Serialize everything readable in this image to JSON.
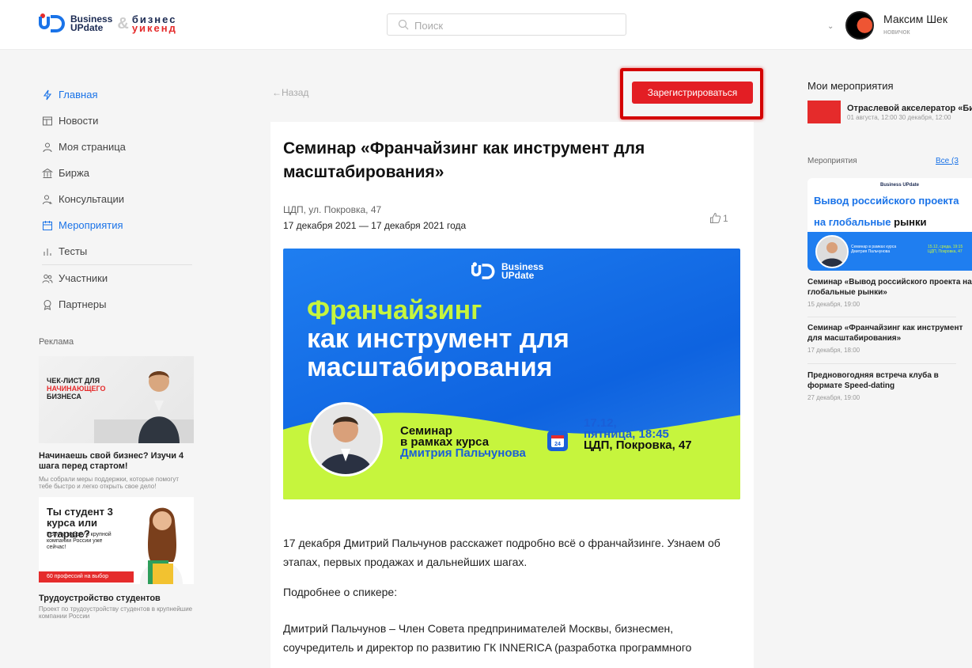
{
  "header": {
    "logo_line1": "Business",
    "logo_line2": "UPdate",
    "logo2_line1": "бизнес",
    "logo2_line2": "уикенд",
    "search_placeholder": "Поиск",
    "user_name": "Максим Шек",
    "user_role": "новичок"
  },
  "sidebar": {
    "items": [
      {
        "label": "Главная",
        "icon": "lightning-icon",
        "active": true
      },
      {
        "label": "Новости",
        "icon": "news-icon",
        "active": false
      },
      {
        "label": "Моя страница",
        "icon": "user-icon",
        "active": false
      },
      {
        "label": "Биржа",
        "icon": "exchange-icon",
        "active": false
      },
      {
        "label": "Консультации",
        "icon": "consult-icon",
        "active": false
      },
      {
        "label": "Мероприятия",
        "icon": "calendar-icon",
        "active": true
      },
      {
        "label": "Тесты",
        "icon": "chart-icon",
        "active": false
      },
      {
        "label": "Участники",
        "icon": "users-icon",
        "active": false
      },
      {
        "label": "Партнеры",
        "icon": "award-icon",
        "active": false
      }
    ],
    "ads_title": "Реклама",
    "ad1": {
      "image_text_1": "ЧЕК-ЛИСТ ДЛЯ",
      "image_text_2": "НАЧИНАЮЩЕГО",
      "image_text_3": "БИЗНЕСА",
      "caption": "Начинаешь свой бизнес? Изучи 4 шага перед стартом!",
      "desc": "Мы собрали меры поддержки, которые помогут тебе быстро и легко открыть свое дело!"
    },
    "ad2": {
      "image_title": "Ты студент 3 курса или старше?",
      "image_sub": "Получи работу в крупной компании России уже сейчас!",
      "badge": "60 профессий на выбор",
      "caption": "Трудоустройство студентов",
      "desc": "Проект по трудоустройству студентов в крупнейшие компании России"
    }
  },
  "main": {
    "back_label": "←Назад",
    "register_label": "Зарегистрироваться",
    "title": "Семинар «Франчайзинг как инструмент для масштабирования»",
    "place": "ЦДП, ул. Покровка, 47",
    "dates": "17 декабря 2021 — 17 декабря 2021 года",
    "likes": "1",
    "banner": {
      "logo_l1": "Business",
      "logo_l2": "UPdate",
      "h1": "Франчайзинг",
      "h2": "как инструмент для масштабирования",
      "sem_l1": "Семинар",
      "sem_l2": "в рамках курса",
      "sem_l3": "Дмитрия Пальчунова",
      "cal_day": "24",
      "date_l1": "17.12,",
      "date_l2": "пятница, 18:45",
      "date_l3": "ЦДП, Покровка, 47"
    },
    "paragraphs": [
      "17 декабря Дмитрий Пальчунов расскажет подробно всё о франчайзинге. Узнаем об этапах, первых продажах и дальнейших шагах.",
      "Подробнее о спикере:",
      "Дмитрий Пальчунов – Член Совета предпринимателей Москвы, бизнесмен, соучредитель и директор по развитию ГК INNERICA (разработка программного"
    ]
  },
  "right": {
    "my_events_title": "Мои мероприятия",
    "my_event_name": "Отраслевой акселератор «Биз",
    "my_event_date": "01 августа, 12:00 30 декабря, 12:00",
    "events_title": "Мероприятия",
    "all_link": "Все (3",
    "banner_logo": "Business UPdate",
    "banner_t1": "Вывод российского проекта",
    "banner_t2_a": "на глобальные",
    "banner_t2_b": "рынки",
    "banner_sm": "Семинар в рамках курса Дмитрия Пальчунова",
    "banner_dt": "15.12, среда, 19:15 ЦДП, Покровка, 47",
    "items": [
      {
        "title": "Семинар «Вывод российского проекта на глобальные рынки»",
        "date": "15 декабря, 19:00"
      },
      {
        "title": "Семинар «Франчайзинг как инструмент для масштабирования»",
        "date": "17 декабря, 18:00"
      },
      {
        "title": "Предновогодняя встреча клуба в формате Speed-dating",
        "date": "27 декабря, 19:00"
      }
    ]
  },
  "colors": {
    "accent": "#1a73e8",
    "brand_red": "#e31e24",
    "lime": "#c6f53d"
  }
}
